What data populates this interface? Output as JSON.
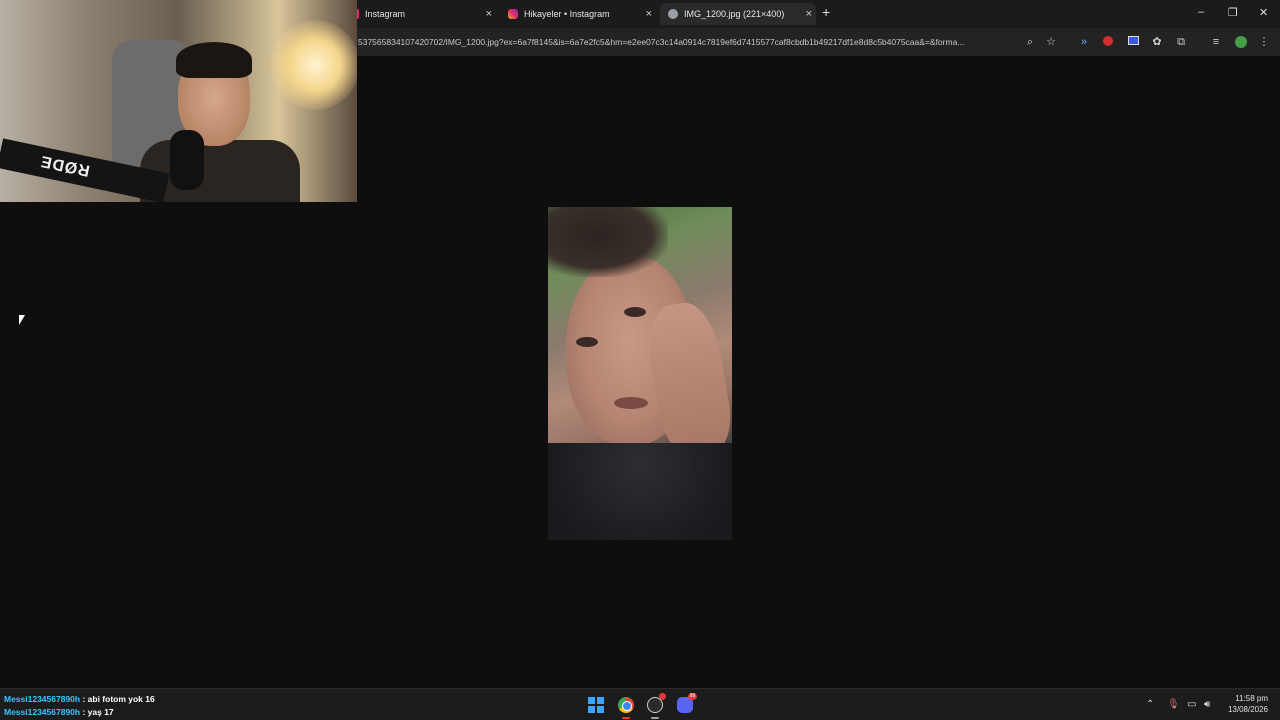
{
  "browser": {
    "tabs": [
      {
        "label": "Instagram",
        "favicon_color": "#e1306c",
        "active": false
      },
      {
        "label": "Hikayeler • Instagram",
        "favicon_color": "#e1306c",
        "active": false
      },
      {
        "label": "IMG_1200.jpg (221×400)",
        "favicon_color": "#9aa0a6",
        "active": true
      }
    ],
    "new_tab_label": "+",
    "close_glyph": "×",
    "window_controls": {
      "minimize": "–",
      "restore": "❐",
      "close": "✕"
    },
    "address": "537565834107420702/IMG_1200.jpg?ex=6a7f8145&is=6a7e2fc5&hm=e2ee07c3c14a0914c7819ef6d7415577caf8cbdb1b49217df1e8d8c5b4075caa&=&forma...",
    "toolbar_icons": [
      "zoom-icon",
      "bookmark-star-icon",
      "extension-icon",
      "extension-icon",
      "extension-icon",
      "extension-icon",
      "puzzle-icon",
      "media-icon",
      "profile-icon",
      "menu-icon"
    ]
  },
  "webcam": {
    "brand_text": "RØDE"
  },
  "chat": [
    {
      "user": "Messi1234567890h",
      "sep": " : ",
      "message": "abi fotom yok 16"
    },
    {
      "user": "Messi1234567890h",
      "sep": " : ",
      "message": "yaş 17"
    }
  ],
  "taskbar": {
    "time": "11:58 pm",
    "date": "13/08/2026",
    "discord_badge": "99"
  },
  "colors": {
    "chat_user": "#39c6ff",
    "accent": "#3aa6ff"
  }
}
